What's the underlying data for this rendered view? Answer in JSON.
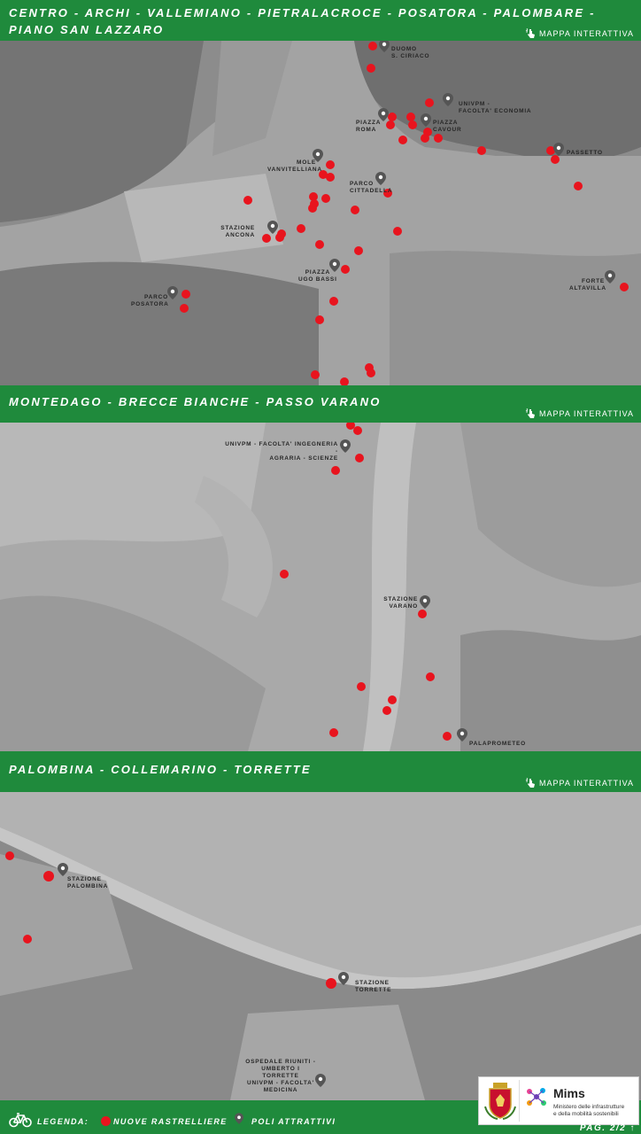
{
  "sections": [
    {
      "title": "CENTRO - ARCHI - VALLEMIANO - PIETRALACROCE - POSATORA - PALOMBARE -\nPIANO SAN LAZZARO",
      "link": "MAPPA INTERATTIVA",
      "pois": [
        {
          "label": "DUOMO\nS. CIRIACO"
        },
        {
          "label": "UNIVPM -\nFACOLTA' ECONOMIA"
        },
        {
          "label": "PIAZZA\nROMA"
        },
        {
          "label": "PIAZZA\nCAVOUR"
        },
        {
          "label": "MOLE\nVANVITELLIANA"
        },
        {
          "label": "PASSETTO"
        },
        {
          "label": "PARCO\nCITTADELLA"
        },
        {
          "label": "STAZIONE\nANCONA"
        },
        {
          "label": "PIAZZA\nUGO BASSI"
        },
        {
          "label": "FORTE\nALTAVILLA"
        },
        {
          "label": "PARCO\nPOSATORA"
        }
      ]
    },
    {
      "title": "MONTEDAGO - BRECCE BIANCHE - PASSO VARANO",
      "link": "MAPPA INTERATTIVA",
      "pois": [
        {
          "label": "UNIVPM - FACOLTA' INGEGNERIA -\nAGRARIA - SCIENZE"
        },
        {
          "label": "STAZIONE\nVARANO"
        },
        {
          "label": "PALAPROMETEO"
        }
      ]
    },
    {
      "title": "PALOMBINA - COLLEMARINO - TORRETTE",
      "link": "MAPPA INTERATTIVA",
      "pois": [
        {
          "label": "STAZIONE\nPALOMBINA"
        },
        {
          "label": "STAZIONE\nTORRETTE"
        },
        {
          "label": "OSPEDALE RIUNITI -\nUMBERTO I TORRETTE\nUNIVPM - FACOLTA'\nMEDICINA"
        }
      ]
    }
  ],
  "legend": {
    "title": "LEGENDA:",
    "racks": "NUOVE RASTRELLIERE",
    "poi": "POLI ATTRATTIVI"
  },
  "logo": {
    "brand": "Mims",
    "ministry": "Ministero delle infrastrutture\ne della mobilità sostenibili"
  },
  "page": "PAG. 2/2",
  "colors": {
    "band": "#1f8a3c",
    "rack": "#e8141e",
    "pin": "#555555"
  }
}
